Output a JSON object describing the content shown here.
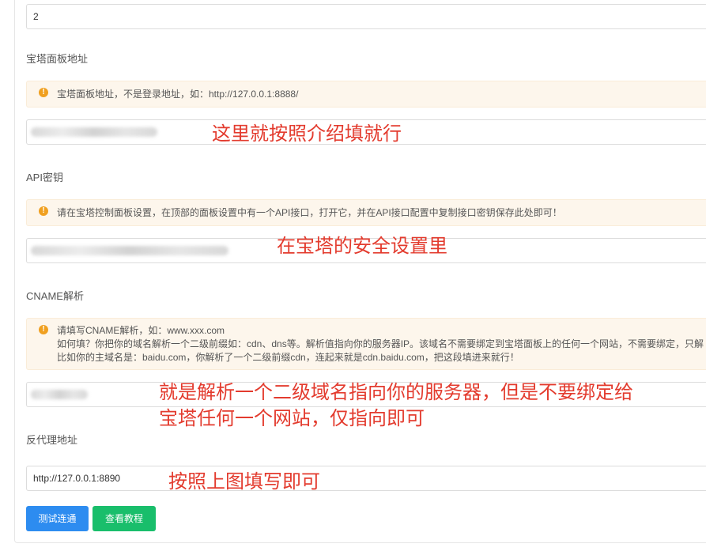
{
  "form": {
    "top_field_value": "2",
    "panel_url": {
      "label": "宝塔面板地址",
      "hint": "宝塔面板地址，不是登录地址，如：http://127.0.0.1:8888/"
    },
    "api_key": {
      "label": "API密钥",
      "hint": "请在宝塔控制面板设置，在顶部的面板设置中有一个API接口，打开它，并在API接口配置中复制接口密钥保存此处即可！"
    },
    "cname": {
      "label": "CNAME解析",
      "hint_line1": "请填写CNAME解析，如：www.xxx.com",
      "hint_line2": "如何填？你把你的域名解析一个二级前缀如：cdn、dns等。解析值指向你的服务器IP。该域名不需要绑定到宝塔面板上的任何一个网站，不需要绑定，只解",
      "hint_line3": "比如你的主域名是：baidu.com，你解析了一个二级前缀cdn，连起来就是cdn.baidu.com，把这段填进来就行！"
    },
    "proxy": {
      "label": "反代理地址",
      "value": "http://127.0.0.1:8890"
    }
  },
  "buttons": {
    "test_label": "测试连通",
    "tutorial_label": "查看教程"
  },
  "annotations": {
    "panel_note": "这里就按照介绍填就行",
    "api_note": "在宝塔的安全设置里",
    "cname_note_line1": "就是解析一个二级域名指向你的服务器，但是不要绑定给",
    "cname_note_line2": "宝塔任何一个网站，仅指向即可",
    "proxy_note": "按照上图填写即可"
  },
  "colors": {
    "primary": "#2d8cf0",
    "success": "#19be6b",
    "warning": "#f0a020",
    "annotation": "#e33b2e"
  }
}
